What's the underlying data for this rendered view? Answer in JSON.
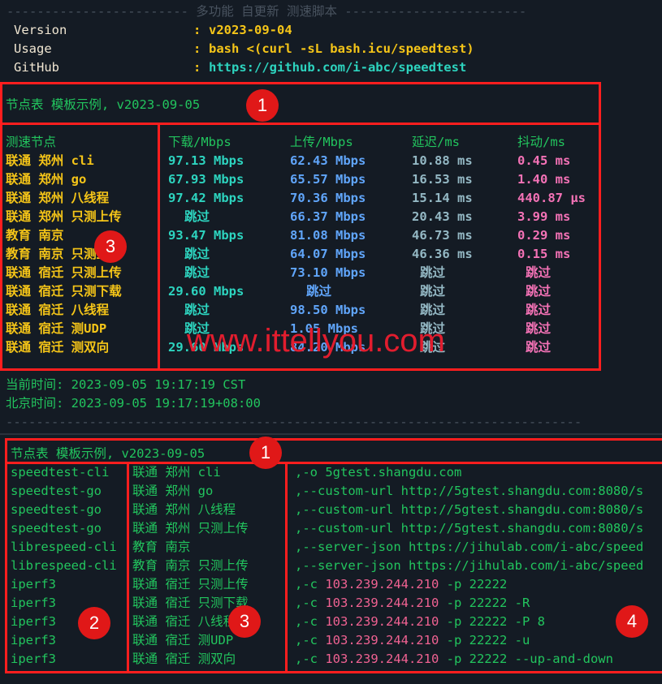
{
  "header": {
    "banner": "------------------------ 多功能 自更新 测速脚本 ------------------------",
    "rows": [
      {
        "label": "Version",
        "value": "v2023-09-04"
      },
      {
        "label": "Usage",
        "value": "bash <(curl -sL bash.icu/speedtest)"
      },
      {
        "label": "GitHub",
        "value": "https://github.com/i-abc/speedtest"
      }
    ],
    "colon": ":"
  },
  "results": {
    "title": "节点表 模板示例, v2023-09-05",
    "headers": [
      "测速节点",
      "下载/Mbps",
      "上传/Mbps",
      "延迟/ms",
      "抖动/ms"
    ],
    "rows": [
      {
        "node": "联通 郑州 cli",
        "down": "97.13 Mbps",
        "up": "62.43 Mbps",
        "lat": "10.88 ms",
        "jit": "0.45 ms"
      },
      {
        "node": "联通 郑州 go",
        "down": "67.93 Mbps",
        "up": "65.57 Mbps",
        "lat": "16.53 ms",
        "jit": "1.40 ms"
      },
      {
        "node": "联通 郑州 八线程",
        "down": "97.42 Mbps",
        "up": "70.36 Mbps",
        "lat": "15.14 ms",
        "jit": "440.87 µs"
      },
      {
        "node": "联通 郑州 只测上传",
        "down": "跳过",
        "up": "66.37 Mbps",
        "lat": "20.43 ms",
        "jit": "3.99 ms"
      },
      {
        "node": "教育 南京",
        "down": "93.47 Mbps",
        "up": "81.08 Mbps",
        "lat": "46.73 ms",
        "jit": "0.29 ms"
      },
      {
        "node": "教育 南京 只测上传",
        "down": "跳过",
        "up": "64.07 Mbps",
        "lat": "46.36 ms",
        "jit": "0.15 ms"
      },
      {
        "node": "联通 宿迁 只测上传",
        "down": "跳过",
        "up": "73.10 Mbps",
        "lat": "跳过",
        "jit": "跳过"
      },
      {
        "node": "联通 宿迁 只测下载",
        "down": "29.60 Mbps",
        "up": "跳过",
        "lat": "跳过",
        "jit": "跳过"
      },
      {
        "node": "联通 宿迁 八线程",
        "down": "跳过",
        "up": "98.50 Mbps",
        "lat": "跳过",
        "jit": "跳过"
      },
      {
        "node": "联通 宿迁 测UDP",
        "down": "跳过",
        "up": "1.05 Mbps",
        "lat": "跳过",
        "jit": "跳过"
      },
      {
        "node": "联通 宿迁 测双向",
        "down": "29.60 Mbps",
        "up": "84.20 Mbps",
        "lat": "跳过",
        "jit": "跳过"
      }
    ]
  },
  "times": {
    "local": "当前时间: 2023-09-05 19:17:19 CST",
    "beijing": "北京时间: 2023-09-05 19:17:19+08:00",
    "rule": "----------------------------------------------------------------------------"
  },
  "template": {
    "title": "节点表 模板示例, v2023-09-05",
    "rows": [
      {
        "tool": "speedtest-cli",
        "node": "联通 郑州 cli",
        "args": ",-o 5gtest.shangdu.com"
      },
      {
        "tool": "speedtest-go",
        "node": "联通 郑州 go",
        "args": ",--custom-url http://5gtest.shangdu.com:8080/s"
      },
      {
        "tool": "speedtest-go",
        "node": "联通 郑州 八线程",
        "args": ",--custom-url http://5gtest.shangdu.com:8080/s"
      },
      {
        "tool": "speedtest-go",
        "node": "联通 郑州 只测上传",
        "args": ",--custom-url http://5gtest.shangdu.com:8080/s"
      },
      {
        "tool": "librespeed-cli",
        "node": "教育 南京",
        "args": ",--server-json https://jihulab.com/i-abc/speed"
      },
      {
        "tool": "librespeed-cli",
        "node": "教育 南京 只测上传",
        "args": ",--server-json https://jihulab.com/i-abc/speed"
      },
      {
        "tool": "iperf3",
        "node": "联通 宿迁 只测上传",
        "pre": ",-c ",
        "ip": "103.239.244.210",
        "post": " -p 22222"
      },
      {
        "tool": "iperf3",
        "node": "联通 宿迁 只测下载",
        "pre": ",-c ",
        "ip": "103.239.244.210",
        "post": " -p 22222 -R"
      },
      {
        "tool": "iperf3",
        "node": "联通 宿迁 八线程",
        "pre": ",-c ",
        "ip": "103.239.244.210",
        "post": " -p 22222 -P 8"
      },
      {
        "tool": "iperf3",
        "node": "联通 宿迁 测UDP",
        "pre": ",-c ",
        "ip": "103.239.244.210",
        "post": " -p 22222 -u"
      },
      {
        "tool": "iperf3",
        "node": "联通 宿迁 测双向",
        "pre": ",-c ",
        "ip": "103.239.244.210",
        "post": " -p 22222 --up-and-down"
      }
    ]
  },
  "annotations": [
    "1",
    "2",
    "3",
    "4"
  ],
  "watermark": "www.ittellyou.com",
  "colors": {
    "annotation": "#ff1e1e",
    "green": "#22c55e",
    "yellow": "#f5c518",
    "cyan": "#2dd4bf",
    "blue": "#60a5fa",
    "pink": "#f472b6"
  }
}
